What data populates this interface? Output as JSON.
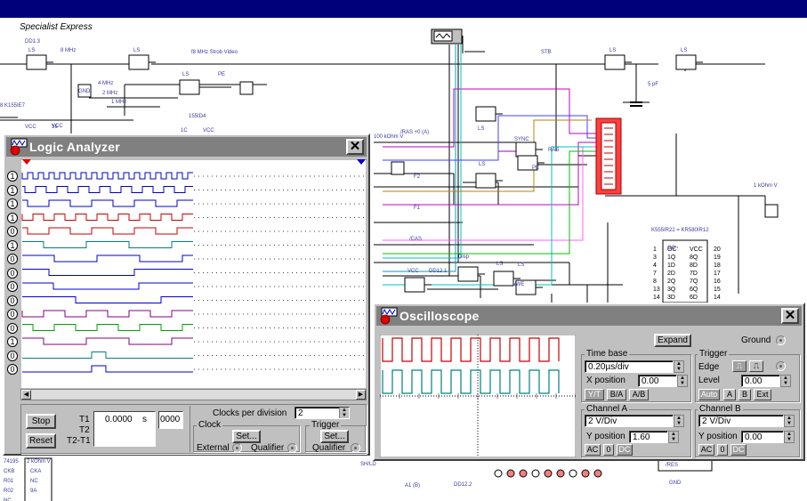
{
  "document": {
    "title": "Specialist Express"
  },
  "schematic": {
    "labels": [
      "DD1.3",
      "LS",
      "8 MHz",
      "LS",
      "f8 MHz Strob Video",
      "LS",
      "PE",
      "4 MHz",
      "2 MHz",
      "1 MHz",
      "STB",
      "LS",
      "LS",
      "5 pF",
      "155ID4",
      "8 K155IE7",
      "1C",
      "VCC",
      "VCC",
      "16",
      "/RAS +0 (A)",
      "LS",
      "SYNC",
      "RAS",
      "LS",
      "PE",
      "F2",
      "F1",
      "/CAS",
      "100 kOhm V",
      "1 kOhm V",
      "K555IR22 = KR580IR12",
      "OC'",
      "VCC",
      "DD12.1",
      "Disp",
      "LS",
      "LS",
      "/WE",
      "A1 (B)",
      "DD12.2",
      "/RES",
      "GND",
      "SH/LD",
      "74195",
      "2 kOhm V",
      "CKB",
      "CKA",
      "R01",
      "NC",
      "R02",
      "9A",
      "NC",
      "VCC",
      "GND",
      "+V",
      "5V"
    ],
    "chip_pins_left": [
      "1",
      "3",
      "4",
      "7",
      "8",
      "13",
      "14"
    ],
    "chip_pin_names_left": [
      "OC'",
      "1Q",
      "1D",
      "2D",
      "2Q",
      "3Q",
      "3D"
    ],
    "chip_pin_names_right": [
      "VCC",
      "8Q",
      "8D",
      "7D",
      "7Q",
      "6Q",
      "6D"
    ],
    "chip_pins_right": [
      "20",
      "19",
      "18",
      "17",
      "16",
      "15",
      "14"
    ]
  },
  "logic_analyzer": {
    "title": "Logic Analyzer",
    "channel_values": [
      "1",
      "1",
      "1",
      "1",
      "0",
      "1",
      "0",
      "0",
      "0",
      "0",
      "0",
      "0",
      "1",
      "0",
      "0"
    ],
    "buttons": {
      "stop": "Stop",
      "reset": "Reset",
      "clock_set": "Set...",
      "trigger_set": "Set..."
    },
    "time_labels": {
      "t1": "T1",
      "t2": "T2",
      "t21": "T2-T1"
    },
    "time_value": "0.0000",
    "time_unit": "s",
    "hex_value": "0000",
    "clocks_per_division_label": "Clocks per division",
    "clocks_per_division": "2",
    "clock_group": "Clock",
    "trigger_group": "Trigger",
    "external_label": "External",
    "qualifier_label": "Qualifier",
    "trigger_qualifier_label": "Qualifier",
    "colors": {
      "blue": "#0000c8",
      "red": "#c80000",
      "teal": "#008080",
      "purple": "#800080",
      "green": "#00a000"
    }
  },
  "oscilloscope": {
    "title": "Oscilloscope",
    "expand_label": "Expand",
    "ground_label": "Ground",
    "time_base": {
      "label": "Time base",
      "value": "0.20µs/div",
      "x_position_label": "X position",
      "x_position": "0.00",
      "modes": [
        "Y/T",
        "B/A",
        "A/B"
      ]
    },
    "trigger": {
      "label": "Trigger",
      "edge_label": "Edge",
      "level_label": "Level",
      "level": "0.00",
      "sources": [
        "Auto",
        "A",
        "B",
        "Ext"
      ]
    },
    "channel_a": {
      "label": "Channel A",
      "value": "2 V/Div",
      "y_position_label": "Y position",
      "y_position": "1.60",
      "coupling": [
        "AC",
        "0",
        "DC"
      ]
    },
    "channel_b": {
      "label": "Channel B",
      "value": "2 V/Div",
      "y_position_label": "Y position",
      "y_position": "0.00",
      "coupling": [
        "AC",
        "0",
        "DC"
      ]
    },
    "colors": {
      "trace_a": "#c80000",
      "trace_b": "#008080"
    }
  }
}
